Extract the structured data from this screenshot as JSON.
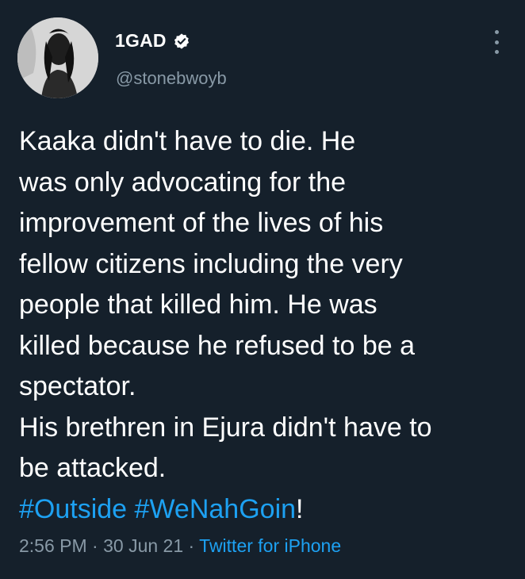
{
  "author": {
    "name": "1GAD",
    "handle": "@stonebwoyb"
  },
  "tweet": {
    "lines": [
      "Kaaka didn't have to die. He",
      "was only advocating for the",
      "improvement of the lives of his",
      "fellow citizens including the very",
      "people that killed him. He was",
      "killed because he refused to be a",
      "spectator.",
      "His brethren in Ejura didn't have to",
      "be attacked."
    ],
    "hashtags": [
      "#Outside",
      "#WeNahGoin"
    ],
    "trailing": "!"
  },
  "meta": {
    "time": "2:56 PM",
    "sep1": " · ",
    "date": "30 Jun 21",
    "sep2": " · ",
    "source": "Twitter for iPhone"
  },
  "icons": {
    "verified": "verified-badge-icon",
    "more": "more-vertical-icon"
  },
  "colors": {
    "background": "#15202b",
    "link": "#1da1f2",
    "secondary": "#8899a6"
  }
}
